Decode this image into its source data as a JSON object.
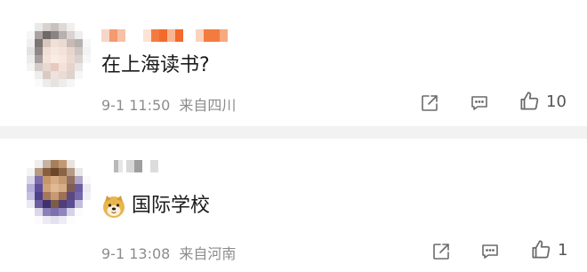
{
  "comments": [
    {
      "text": "在上海读书?",
      "time": "9-1 11:50",
      "location": "来自四川",
      "likes": "10",
      "emoji": null
    },
    {
      "text": "国际学校",
      "time": "9-1 13:08",
      "location": "来自河南",
      "likes": "1",
      "emoji": "doge-emoji"
    }
  ],
  "icons": {
    "share": "share-icon",
    "comment": "comment-icon",
    "like": "thumbs-up-icon"
  },
  "colors": {
    "meta_text": "#8c8c8c",
    "divider": "#f2f2f2",
    "icon_stroke": "#6a6a6a"
  }
}
